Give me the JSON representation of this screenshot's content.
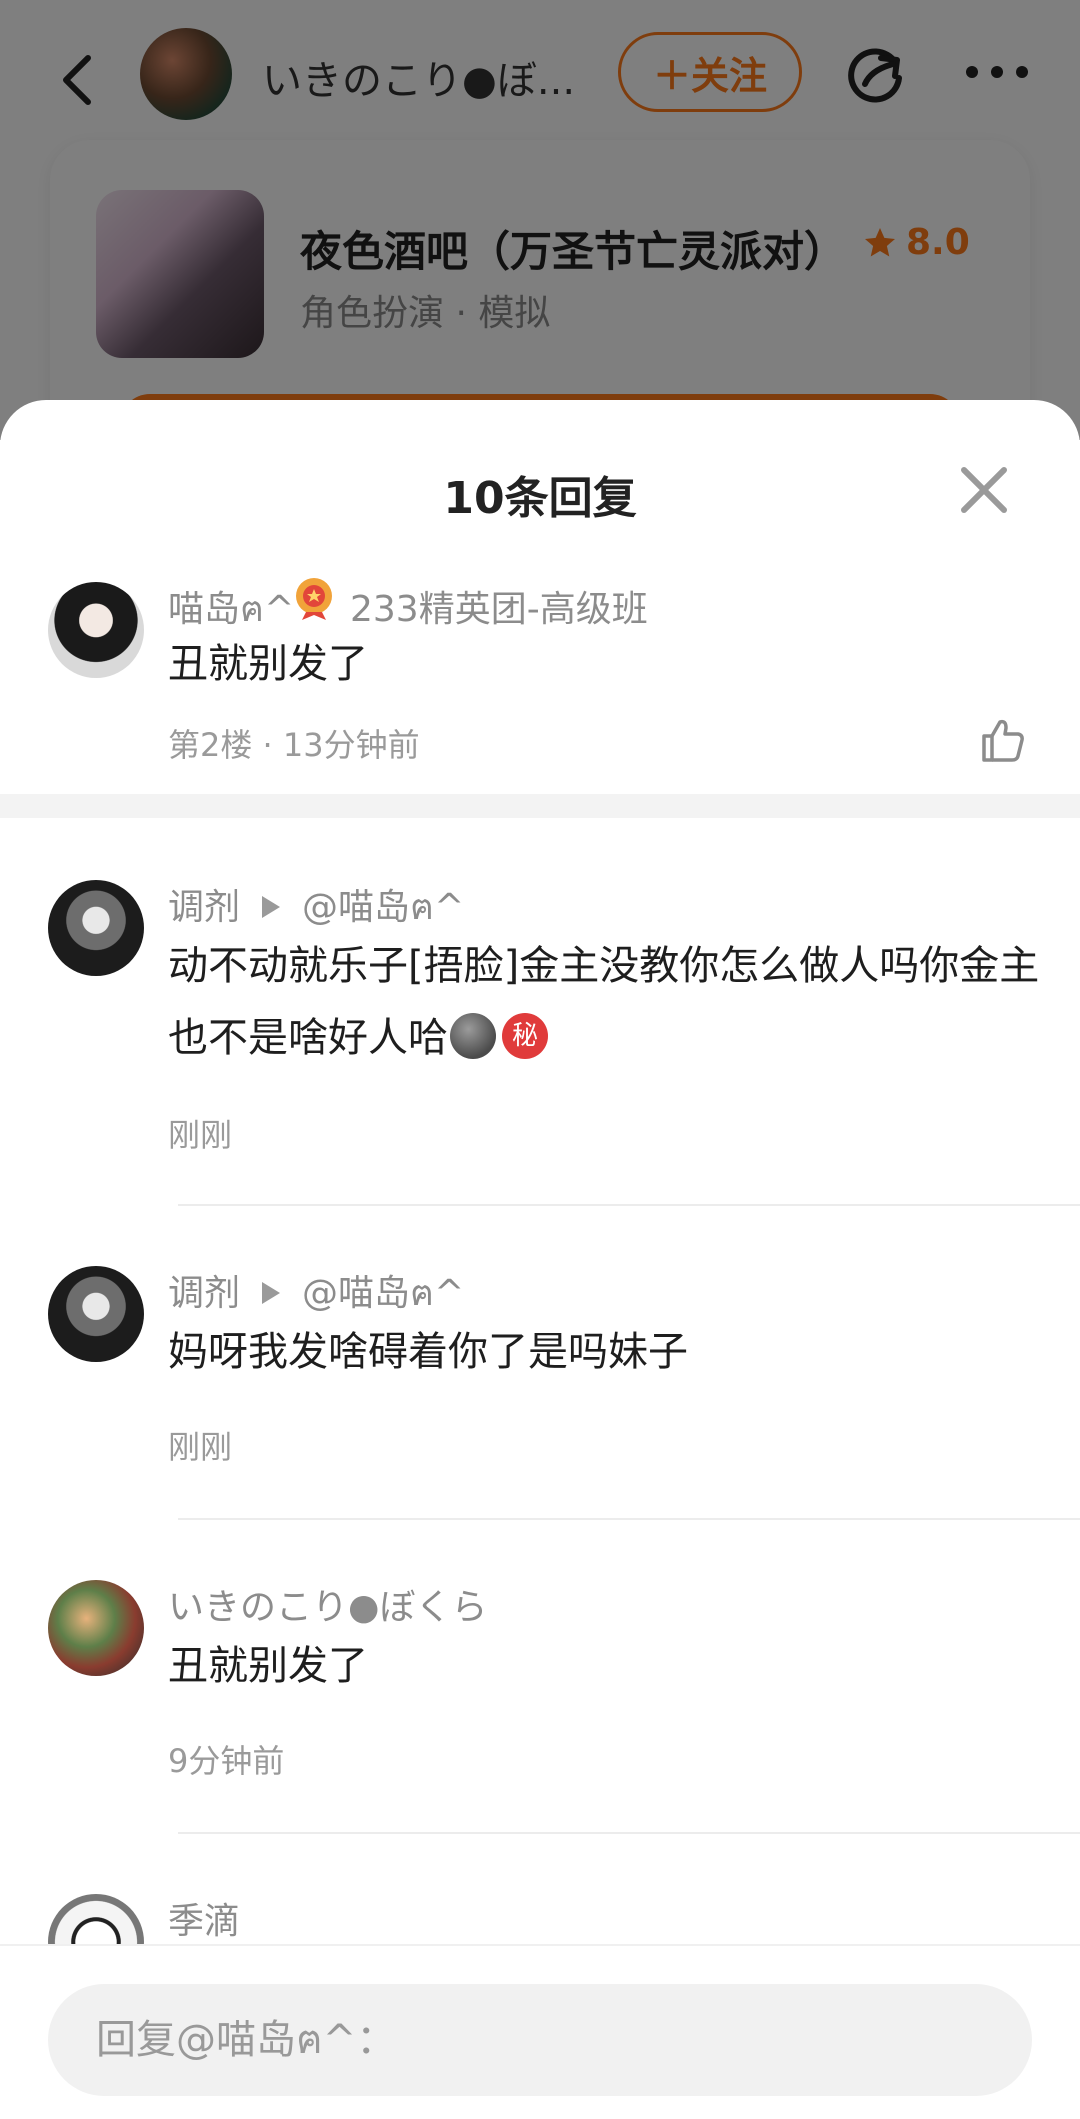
{
  "header": {
    "author_name": "いきのこり●ぼ...",
    "follow_label": "＋关注"
  },
  "game": {
    "title": "夜色酒吧（万圣节亡灵派对）",
    "score": "8.0",
    "tags": "角色扮演 · 模拟"
  },
  "sheet": {
    "title": "10条回复",
    "main_comment": {
      "user": "喵岛ฅ^",
      "badge": "233精英团-高级班",
      "text": "丑就别发了",
      "meta": "第2楼 · 13分钟前"
    },
    "replies": [
      {
        "user": "调剂",
        "target": "@喵岛ฅ^",
        "text": "动不动就乐子[捂脸]金主没教你怎么做人吗你金主也不是啥好人哈",
        "emoji_secret": "秘",
        "time": "刚刚"
      },
      {
        "user": "调剂",
        "target": "@喵岛ฅ^",
        "text": "妈呀我发啥碍着你了是吗妹子",
        "time": "刚刚"
      },
      {
        "user": "いきのこり●ぼくら",
        "text": "丑就别发了",
        "time": "9分钟前"
      },
      {
        "user": "季滴"
      }
    ]
  },
  "input": {
    "placeholder": "回复@喵岛ฅ^："
  },
  "colors": {
    "accent": "#ff7a1a",
    "muted": "#8c8c8c"
  }
}
